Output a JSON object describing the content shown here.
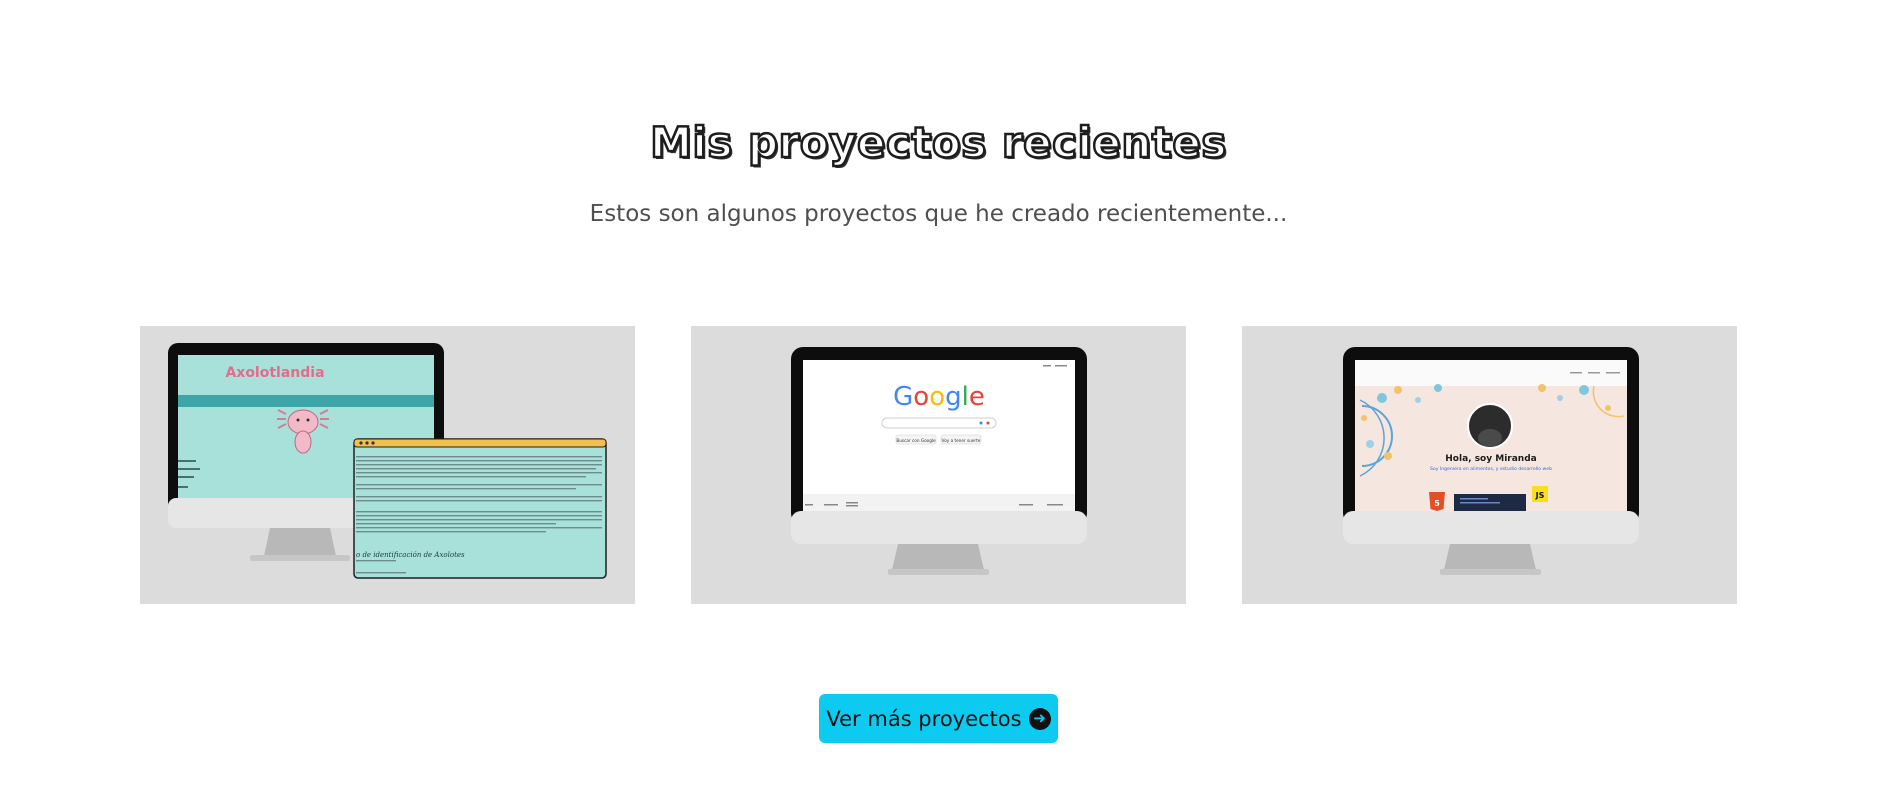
{
  "section": {
    "title": "Mis proyectos recientes",
    "subtitle": "Estos son algunos proyectos que he creado recientemente..."
  },
  "projects": [
    {
      "screen_title": "Axolotlandia",
      "screen_caption": "o de identificación de Axolotes",
      "colors": {
        "screen_bg": "#a8e0da",
        "title": "#e66b8a",
        "band": "#3ea5a8"
      }
    },
    {
      "logo_text": "Google",
      "search_button": "Buscar con Google",
      "lucky_button": "Voy a tener suerte",
      "colors": {
        "blue": "#4285f4",
        "red": "#ea4335",
        "yellow": "#fbbc05",
        "green": "#34a853"
      }
    },
    {
      "greeting": "Hola, soy Miranda",
      "tagline": "Soy Ingeniera en alimentos, y estudio desarrollo web",
      "badge_js": "JS",
      "colors": {
        "screen_bg": "#f6e6e0",
        "tagline": "#2e6fd6"
      }
    }
  ],
  "cta": {
    "label": "Ver más proyectos",
    "icon": "arrow-right-circle-icon",
    "color": "#0dcaf0"
  }
}
